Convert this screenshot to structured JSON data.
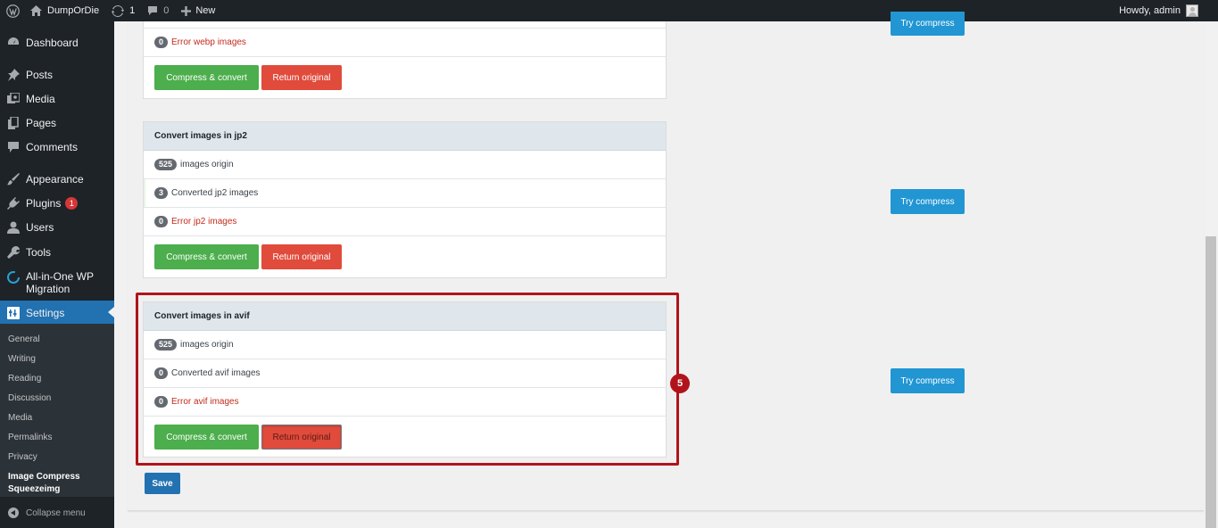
{
  "adminbar": {
    "site_name": "DumpOrDie",
    "updates_count": "1",
    "comments_count": "0",
    "new_label": "New",
    "howdy": "Howdy, admin"
  },
  "sidebar": {
    "items": [
      {
        "label": "Dashboard",
        "icon": "dashboard-icon"
      },
      {
        "label": "Posts",
        "icon": "pin-icon"
      },
      {
        "label": "Media",
        "icon": "media-icon"
      },
      {
        "label": "Pages",
        "icon": "pages-icon"
      },
      {
        "label": "Comments",
        "icon": "comment-icon"
      },
      {
        "label": "Appearance",
        "icon": "brush-icon"
      },
      {
        "label": "Plugins",
        "icon": "plugin-icon",
        "badge": "1"
      },
      {
        "label": "Users",
        "icon": "user-icon"
      },
      {
        "label": "Tools",
        "icon": "wrench-icon"
      },
      {
        "label": "All-in-One WP Migration",
        "icon": "migration-icon"
      },
      {
        "label": "Settings",
        "icon": "settings-icon",
        "active": true
      }
    ],
    "submenu": [
      "General",
      "Writing",
      "Reading",
      "Discussion",
      "Media",
      "Permalinks",
      "Privacy",
      "Image Compress Squeezeimg"
    ],
    "collapse_label": "Collapse menu"
  },
  "top_panel": {
    "error_count": "0",
    "error_label": "Error webp images",
    "compress_label": "Compress & convert",
    "return_label": "Return original"
  },
  "jp2_panel": {
    "title": "Convert images in jp2",
    "origin_count": "525",
    "origin_label": "images origin",
    "converted_count": "3",
    "converted_label": "Converted jp2 images",
    "error_count": "0",
    "error_label": "Error jp2 images",
    "compress_label": "Compress & convert",
    "return_label": "Return original"
  },
  "avif_panel": {
    "title": "Convert images in avif",
    "origin_count": "525",
    "origin_label": "images origin",
    "converted_count": "0",
    "converted_label": "Converted avif images",
    "error_count": "0",
    "error_label": "Error avif images",
    "compress_label": "Compress & convert",
    "return_label": "Return original"
  },
  "try_compress_label": "Try compress",
  "save_label": "Save",
  "step_marker": "5",
  "colors": {
    "accent": "#2271b1",
    "green": "#4cae4c",
    "red": "#e04b3c",
    "highlight": "#b0141a",
    "try_blue": "#2196d3"
  }
}
